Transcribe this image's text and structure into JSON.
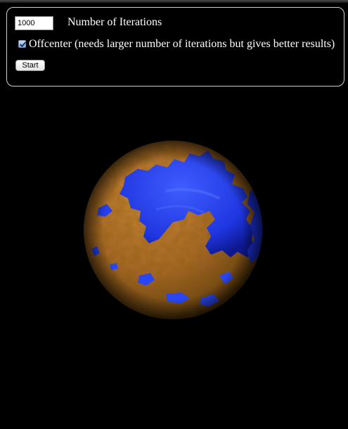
{
  "controls": {
    "iterations_value": "1000",
    "iterations_label": "Number of Iterations",
    "offcenter_checked": true,
    "offcenter_label": "Offcenter (needs larger number of iterations but gives better results)",
    "start_label": "Start"
  },
  "scene": {
    "background_color": "#000000",
    "land_color": "#b7742c",
    "ocean_color": "#1e3fff",
    "icons": [
      "planet-sphere"
    ]
  }
}
